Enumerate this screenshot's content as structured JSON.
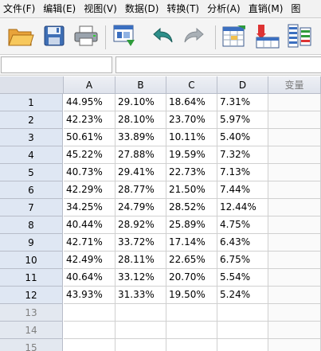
{
  "menu": [
    "文件(F)",
    "编辑(E)",
    "视图(V)",
    "数据(D)",
    "转换(T)",
    "分析(A)",
    "直销(M)",
    "图"
  ],
  "toolbar": {
    "icons": [
      "open-folder-icon",
      "save-disk-icon",
      "print-icon",
      "recall-dialog-icon",
      "undo-icon",
      "redo-icon",
      "goto-case-icon",
      "goto-variable-icon",
      "variables-icon"
    ]
  },
  "editor": {
    "cell_name": "",
    "cell_value": ""
  },
  "grid": {
    "columns": [
      "A",
      "B",
      "C",
      "D",
      "变量"
    ],
    "rows": [
      {
        "num": "1",
        "cells": [
          "44.95%",
          "29.10%",
          "18.64%",
          "7.31%",
          ""
        ]
      },
      {
        "num": "2",
        "cells": [
          "42.23%",
          "28.10%",
          "23.70%",
          "5.97%",
          ""
        ]
      },
      {
        "num": "3",
        "cells": [
          "50.61%",
          "33.89%",
          "10.11%",
          "5.40%",
          ""
        ]
      },
      {
        "num": "4",
        "cells": [
          "45.22%",
          "27.88%",
          "19.59%",
          "7.32%",
          ""
        ]
      },
      {
        "num": "5",
        "cells": [
          "40.73%",
          "29.41%",
          "22.73%",
          "7.13%",
          ""
        ]
      },
      {
        "num": "6",
        "cells": [
          "42.29%",
          "28.77%",
          "21.50%",
          "7.44%",
          ""
        ]
      },
      {
        "num": "7",
        "cells": [
          "34.25%",
          "24.79%",
          "28.52%",
          "12.44%",
          ""
        ]
      },
      {
        "num": "8",
        "cells": [
          "40.44%",
          "28.92%",
          "25.89%",
          "4.75%",
          ""
        ]
      },
      {
        "num": "9",
        "cells": [
          "42.71%",
          "33.72%",
          "17.14%",
          "6.43%",
          ""
        ]
      },
      {
        "num": "10",
        "cells": [
          "42.49%",
          "28.11%",
          "22.65%",
          "6.75%",
          ""
        ]
      },
      {
        "num": "11",
        "cells": [
          "40.64%",
          "33.12%",
          "20.70%",
          "5.54%",
          ""
        ]
      },
      {
        "num": "12",
        "cells": [
          "43.93%",
          "31.33%",
          "19.50%",
          "5.24%",
          ""
        ]
      },
      {
        "num": "13",
        "cells": [
          "",
          "",
          "",
          "",
          ""
        ]
      },
      {
        "num": "14",
        "cells": [
          "",
          "",
          "",
          "",
          ""
        ]
      },
      {
        "num": "15",
        "cells": [
          "",
          "",
          "",
          "",
          ""
        ]
      }
    ]
  }
}
